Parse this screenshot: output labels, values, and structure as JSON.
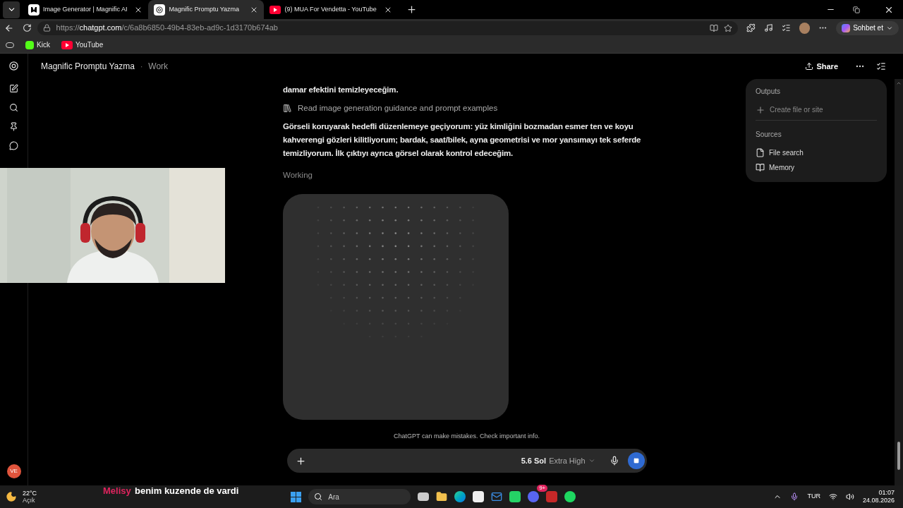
{
  "browser": {
    "tabs": [
      {
        "title": "Image Generator | Magnific AI",
        "kind": "magnific",
        "selected": false
      },
      {
        "title": "Magnific Promptu Yazma",
        "kind": "chatgpt",
        "selected": true
      },
      {
        "title": "(9) MUA For Vendetta - YouTube",
        "kind": "youtube",
        "selected": false
      }
    ],
    "url_host": "chatgpt.com",
    "url_prefix": "https://",
    "url_path": "/c/6a8b6850-49b4-83eb-ad9c-1d3170b674ab",
    "copilot": "Sohbet et",
    "bookmarks": [
      {
        "label": "Kick",
        "kind": "kick"
      },
      {
        "label": "YouTube",
        "kind": "youtube"
      }
    ]
  },
  "header": {
    "title": "Magnific Promptu Yazma",
    "separator": "·",
    "project": "Work",
    "share": "Share"
  },
  "messages": [
    {
      "kind": "paragraph",
      "text": "damar efektini temizleyeceğim."
    },
    {
      "kind": "tool",
      "text": "Read image generation guidance and prompt examples"
    },
    {
      "kind": "paragraph",
      "text": "Görseli koruyarak hedefli düzenlemeye geçiyorum: yüz kimliğini bozmadan esmer ten ve koyu kahverengi gözleri kilitliyorum; bardak, saat/bilek, ayna geometrisi ve mor yansımayı tek seferde temizliyorum. İlk çıktıyı ayrıca görsel olarak kontrol edeceğim."
    },
    {
      "kind": "status",
      "text": "Working"
    },
    {
      "kind": "image_loading"
    }
  ],
  "side_panel": {
    "sections": [
      {
        "title": "Outputs",
        "items": [
          {
            "label": "Create file or site",
            "kind": "create"
          }
        ]
      },
      {
        "title": "Sources",
        "items": [
          {
            "label": "File search",
            "kind": "file"
          },
          {
            "label": "Memory",
            "kind": "memory"
          }
        ]
      }
    ]
  },
  "disclaimer": "ChatGPT can make mistakes. Check important info.",
  "composer": {
    "model": "5.6 Sol",
    "effort": "Extra High",
    "generating": true
  },
  "avatar": "VE",
  "taskbar": {
    "temperature": "22°C",
    "weather": "Açık",
    "chat_user": "Melisy",
    "chat_message": "benim kuzende de vardi",
    "search": "Ara",
    "language": "TUR",
    "time": "01:07",
    "date": "24.08.2026",
    "discord_badge": "9+"
  }
}
